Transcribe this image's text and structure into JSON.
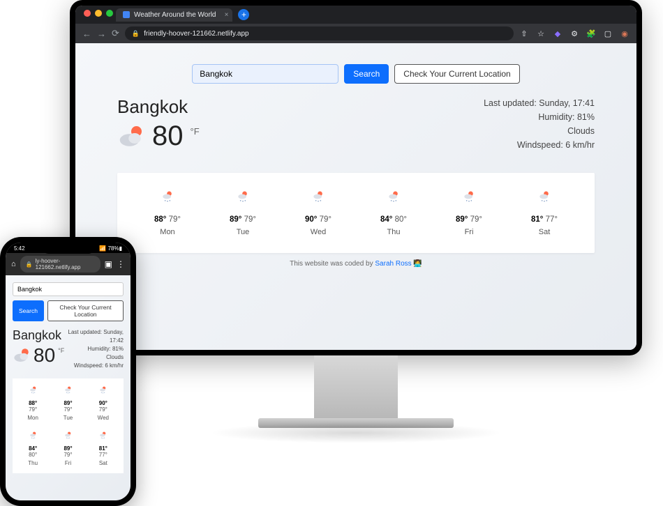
{
  "browser": {
    "tab_title": "Weather Around the World",
    "url": "friendly-hoover-121662.netlify.app"
  },
  "search": {
    "value": "Bangkok",
    "search_label": "Search",
    "location_label": "Check Your Current Location"
  },
  "current": {
    "city": "Bangkok",
    "temp": "80",
    "unit": "°F",
    "last_updated_label": "Last updated: Sunday, 17:41",
    "humidity_label": "Humidity: 81%",
    "condition": "Clouds",
    "windspeed_label": "Windspeed: 6 km/hr"
  },
  "forecast": [
    {
      "hi": "88°",
      "lo": "79°",
      "day": "Mon"
    },
    {
      "hi": "89°",
      "lo": "79°",
      "day": "Tue"
    },
    {
      "hi": "90°",
      "lo": "79°",
      "day": "Wed"
    },
    {
      "hi": "84°",
      "lo": "80°",
      "day": "Thu"
    },
    {
      "hi": "89°",
      "lo": "79°",
      "day": "Fri"
    },
    {
      "hi": "81°",
      "lo": "77°",
      "day": "Sat"
    }
  ],
  "footer": {
    "prefix": "This website was coded by ",
    "author": "Sarah Ross",
    "emoji": "👩‍💻"
  },
  "phone": {
    "status_time": "5:42",
    "status_right": "📶 78%▮",
    "url": "ly-hoover-121662.netlify.app",
    "search_value": "Bangkok",
    "search_label": "Search",
    "location_label": "Check Your Current Location",
    "city": "Bangkok",
    "temp": "80",
    "unit": "°F",
    "last_updated_label": "Last updated: Sunday, 17:42",
    "humidity_label": "Humidity: 81%",
    "condition": "Clouds",
    "windspeed_label": "Windspeed: 6 km/hr",
    "forecast": [
      {
        "hi": "88°",
        "lo": "79°",
        "day": "Mon"
      },
      {
        "hi": "89°",
        "lo": "79°",
        "day": "Tue"
      },
      {
        "hi": "90°",
        "lo": "79°",
        "day": "Wed"
      },
      {
        "hi": "84°",
        "lo": "80°",
        "day": "Thu"
      },
      {
        "hi": "89°",
        "lo": "79°",
        "day": "Fri"
      },
      {
        "hi": "81°",
        "lo": "77°",
        "day": "Sat"
      }
    ]
  }
}
